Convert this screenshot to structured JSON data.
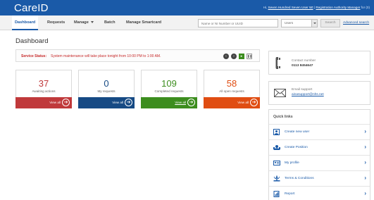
{
  "header": {
    "logo": "CareID",
    "greeting": "Hi,",
    "user_name": "Seven Hundred Seven User Wt",
    "separator": "|",
    "role": "Registration Authority Manager",
    "role_suffix": "for (0)"
  },
  "nav": {
    "items": [
      {
        "label": "Dashboard",
        "active": true
      },
      {
        "label": "Requests"
      },
      {
        "label": "Manage"
      },
      {
        "label": "Batch"
      },
      {
        "label": "Manage Smartcard"
      }
    ],
    "search_placeholder": "Name or NI Number or UUID",
    "scope_selected": "Users",
    "search_button": "Search",
    "advanced_search": "Advanced search"
  },
  "page_title": "Dashboard",
  "service_status": {
    "label": "Service Status:",
    "message": "System maintenance will take place tonight from 10:00 PM to 1:00 AM."
  },
  "cards": [
    {
      "count": "37",
      "label": "Awaiting actions",
      "link": "View all",
      "color": "#c0393b",
      "count_color": "#c0393b"
    },
    {
      "count": "0",
      "label": "My requests",
      "link": "View all",
      "color": "#164a84",
      "count_color": "#164a84"
    },
    {
      "count": "109",
      "label": "Completed requests",
      "link": "View all",
      "color": "#3c8d1e",
      "count_color": "#3c8d1e"
    },
    {
      "count": "58",
      "label": "All open requests",
      "link": "View all",
      "color": "#e04d12",
      "count_color": "#e04d12"
    }
  ],
  "contact": {
    "label": "Contact number",
    "number": "0113 8454647"
  },
  "email_support": {
    "label": "Email support",
    "address": "ainasupport@nhs.net"
  },
  "quick_links": {
    "title": "Quick links",
    "items": [
      {
        "label": "Create new user",
        "icon": "add-user-icon"
      },
      {
        "label": "Create Position",
        "icon": "position-icon"
      },
      {
        "label": "My profile",
        "icon": "profile-card-icon"
      },
      {
        "label": "Terms & Conditions",
        "icon": "terms-icon"
      },
      {
        "label": "Report",
        "icon": "report-icon"
      }
    ]
  }
}
